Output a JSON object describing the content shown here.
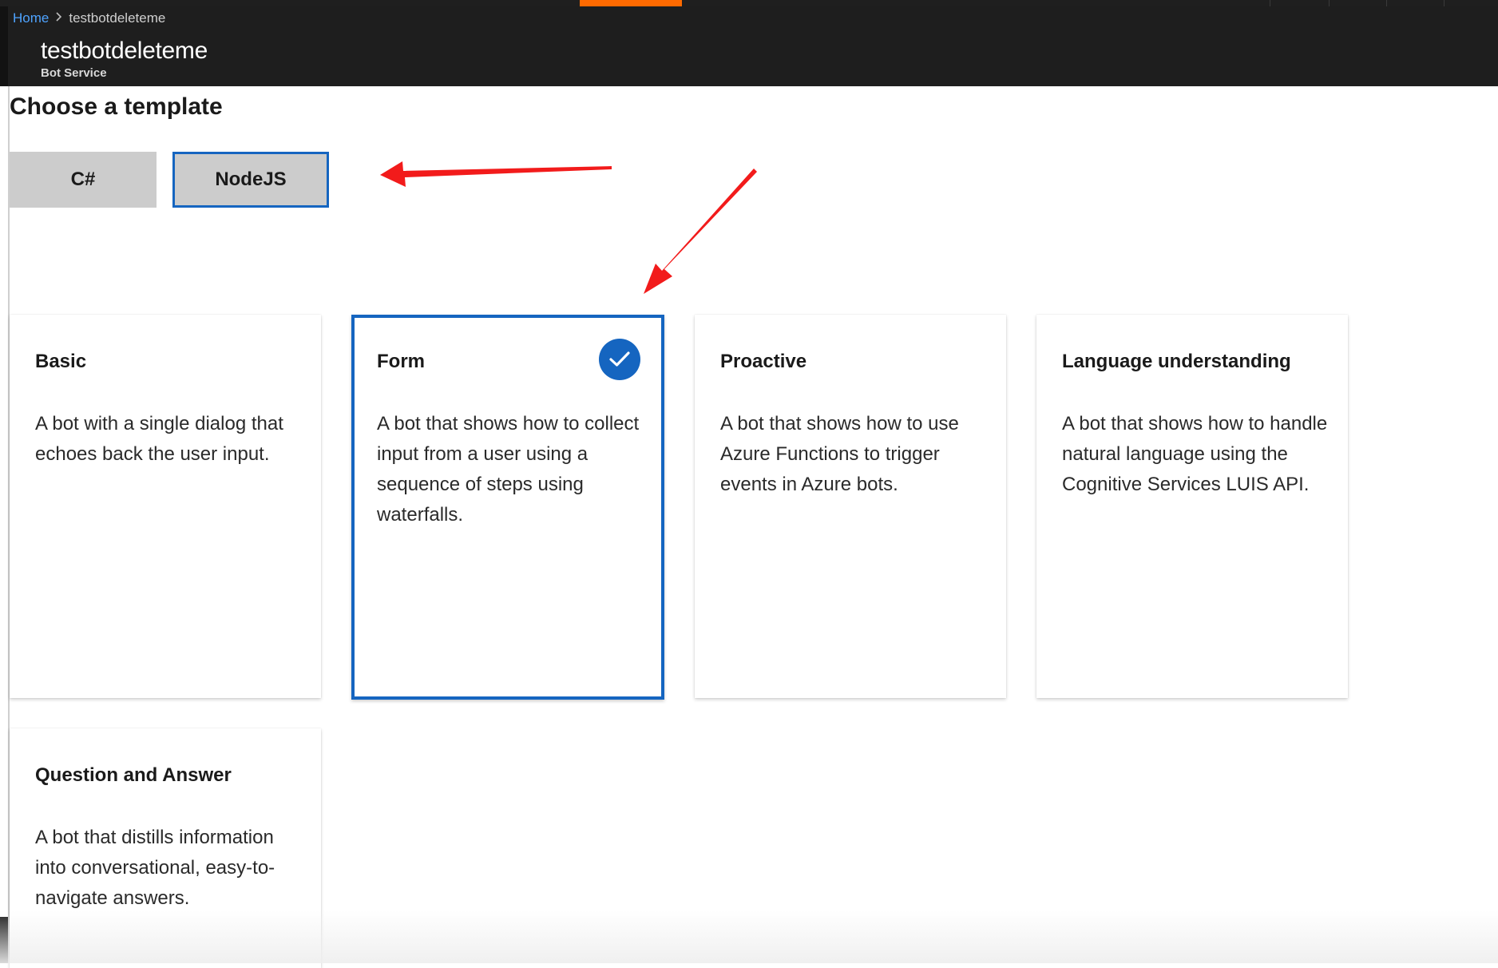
{
  "breadcrumb": {
    "home_label": "Home",
    "separator": ">",
    "current_label": "testbotdeleteme"
  },
  "resource": {
    "title": "testbotdeleteme",
    "subtitle": "Bot Service"
  },
  "page": {
    "heading": "Choose a template"
  },
  "languages": {
    "items": [
      {
        "label": "C#",
        "selected": false
      },
      {
        "label": "NodeJS",
        "selected": true
      }
    ]
  },
  "templates": {
    "items": [
      {
        "title": "Basic",
        "description": "A bot with a single dialog that echoes back the user input.",
        "selected": false
      },
      {
        "title": "Form",
        "description": "A bot that shows how to collect input from a user using a sequence of steps using waterfalls.",
        "selected": true
      },
      {
        "title": "Proactive",
        "description": "A bot that shows how to use Azure Functions to trigger events in Azure bots.",
        "selected": false
      },
      {
        "title": "Language understanding",
        "description": "A bot that shows how to handle natural language using the Cognitive Services LUIS API.",
        "selected": false
      },
      {
        "title": "Question and Answer",
        "description": "A bot that distills information into conversational, easy-to-navigate answers.",
        "selected": false
      }
    ]
  },
  "icons": {
    "selected_indicator": "checkmark-icon",
    "breadcrumb_separator": "chevron-right-icon"
  },
  "colors": {
    "accent_blue": "#1565c0",
    "portal_orange": "#ff6a00",
    "header_bg": "#1e1e1e",
    "annotation_red": "#f21b1b",
    "button_gray": "#cccccc"
  }
}
